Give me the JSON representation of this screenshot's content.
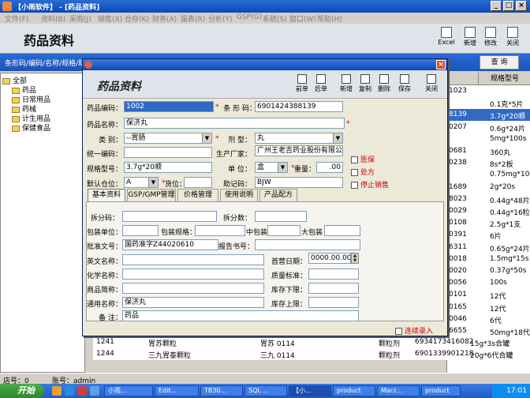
{
  "window": {
    "title": "【小雨软件】 - [药品资料]"
  },
  "menu": [
    "文件(F)",
    "资料(B)",
    "采购(J)",
    "销售(X)",
    "仓存(K)",
    "财务(A)",
    "报表(R)",
    "分析(Y)",
    "GSP(G)",
    "系统(S)",
    "窗口(W)",
    "帮助(H)"
  ],
  "header": {
    "title": "药品资料",
    "buttons": [
      "Excel",
      "新增",
      "修改",
      "关闭"
    ]
  },
  "search": {
    "label": "条形码/编码/名称/规格/助记码",
    "button": "查 询"
  },
  "tree": {
    "root": "全部",
    "items": [
      "药品",
      "日常用品",
      "药械",
      "计生用品",
      "保健食品"
    ]
  },
  "grid": {
    "col1_header": "",
    "col2_header": "规格型号",
    "rows": [
      [
        "1023",
        ""
      ],
      [
        "",
        "0.1克*5片"
      ],
      [
        "8139",
        "3.7g*20顺"
      ],
      [
        "0207",
        "0.6g*24片"
      ],
      [
        "",
        "5mg*100s"
      ],
      [
        "0681",
        "360丸"
      ],
      [
        "0238",
        "8s*2板"
      ],
      [
        "",
        "0.75mg*100S"
      ],
      [
        "1689",
        "2g*20s"
      ],
      [
        "8023",
        "0.44g*48片"
      ],
      [
        "0029",
        "0.44g*16粒"
      ],
      [
        "0108",
        "2.5g*1支"
      ],
      [
        "0391",
        "6片"
      ],
      [
        "6311",
        "0.65g*24片"
      ],
      [
        "0018",
        "1.5mg*15s"
      ],
      [
        "0020",
        "0.37g*50s"
      ],
      [
        "0056",
        "100s"
      ],
      [
        "0101",
        "12代"
      ],
      [
        "0165",
        "12代"
      ],
      [
        "0046",
        "6代"
      ],
      [
        "6655",
        "50mg*18代"
      ],
      [
        "5478",
        "4g*12代"
      ]
    ],
    "bottom_rows": [
      [
        "1241",
        "胃苏颗粒",
        "胃苏 0114",
        "颗粒剂",
        "6934173416082",
        "15g*3s合罐"
      ],
      [
        "1244",
        "三九胃泰颗粒",
        "三九 0114",
        "颗粒剂",
        "6901339901218",
        "20g*6代合罐"
      ]
    ]
  },
  "dialog": {
    "title": "药品资料",
    "buttons": [
      "前单",
      "后单",
      "新增",
      "复制",
      "删除",
      "保存",
      "关闭"
    ],
    "fields": {
      "code_label": "药品编码：",
      "code": "1002",
      "barcode_label": "条 形 码：",
      "barcode": "6901424388139",
      "name_label": "药品名称：",
      "name": "保济丸",
      "category_label": "类 别：",
      "category": "--胃肠",
      "dosage_label": "剂 型：",
      "dosage": "丸",
      "unified_label": "统一编码：",
      "unified": "",
      "maker_label": "生产厂家：",
      "maker": "广州王老吉药业股份有限公司",
      "spec_label": "规格型号：",
      "spec": "3.7g*20顺",
      "unit_label": "单 位：",
      "unit": "盒",
      "weight_label": "重量：",
      "weight": ".00",
      "loc_label": "默认仓位：",
      "loc": "A",
      "shelf_label": "货位：",
      "shelf": "",
      "mnemonic_label": "助记码：",
      "mnemonic": "BJW"
    },
    "checks": [
      "医保",
      "处方",
      "停止销售"
    ],
    "tabs": [
      "基本资料",
      "GSP/GMP管理",
      "价格管理",
      "使用说明",
      "产品配方"
    ],
    "basic": {
      "split_code": "拆分码：",
      "split_count": "拆分数：",
      "pack_unit": "包装单位：",
      "pack": "包装规格：",
      "mid_pack": "中包装",
      "big_pack": "大包装",
      "approval_label": "批准文号：",
      "approval": "国药准字Z44020610",
      "report_label": "报告书号：",
      "en_name": "英文名称：",
      "first_date_label": "首营日期：",
      "first_date": "0000.00.00",
      "chem_name": "化学名称：",
      "quality": "质量标准：",
      "trade_name": "商品简称：",
      "stock_low": "库存下限：",
      "common_label": "通用名称：",
      "common": "保济丸",
      "stock_high": "库存上限：",
      "remark_label": "备 注：",
      "remark": "药品"
    },
    "continuous": "连续录入"
  },
  "status": {
    "store": "店号：0",
    "account": "账号：admin"
  },
  "taskbar": {
    "start": "开始",
    "tasks": [
      "小雨...",
      "Edit...",
      "TB30...",
      "SQL ...",
      "【小...",
      "product",
      "Macr...",
      "product"
    ],
    "clock": "17:01"
  },
  "colors": {
    "title_blue": "#0b48b8",
    "selected_row": "#316ac5"
  }
}
